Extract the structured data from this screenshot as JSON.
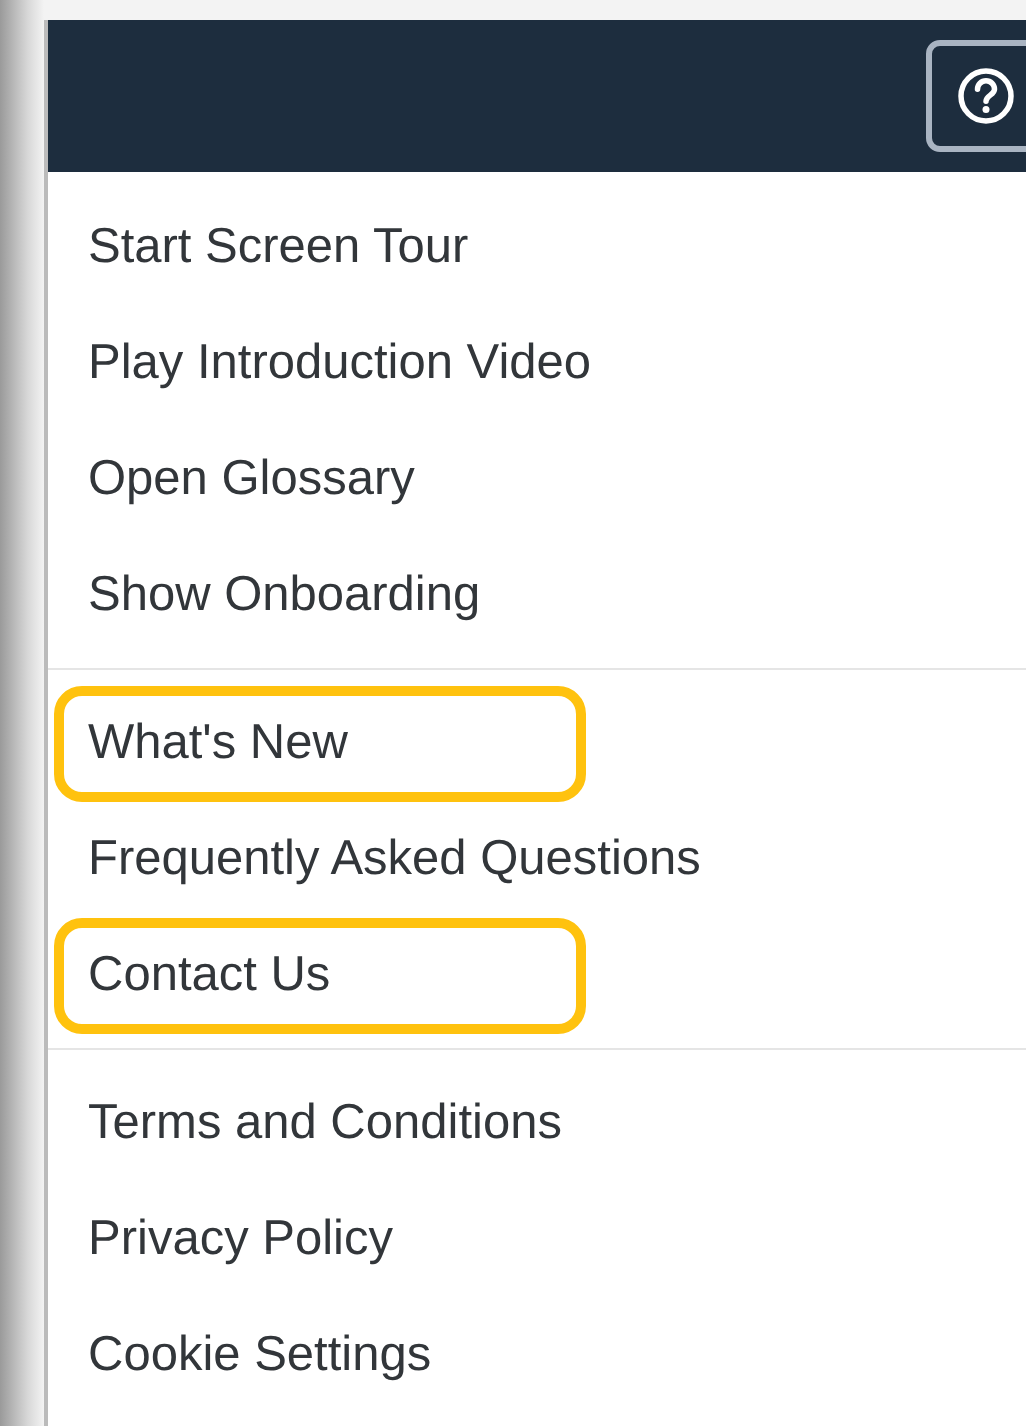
{
  "header": {
    "help_button": {
      "selected": true
    }
  },
  "menu": {
    "sections": [
      {
        "items": [
          {
            "label": "Start Screen Tour",
            "highlighted": false
          },
          {
            "label": "Play Introduction Video",
            "highlighted": false
          },
          {
            "label": "Open Glossary",
            "highlighted": false
          },
          {
            "label": "Show Onboarding",
            "highlighted": false
          }
        ]
      },
      {
        "items": [
          {
            "label": "What's New",
            "highlighted": true
          },
          {
            "label": "Frequently Asked Questions",
            "highlighted": false
          },
          {
            "label": "Contact Us",
            "highlighted": true
          }
        ]
      },
      {
        "items": [
          {
            "label": "Terms and Conditions",
            "highlighted": false
          },
          {
            "label": "Privacy Policy",
            "highlighted": false
          },
          {
            "label": "Cookie Settings",
            "highlighted": false
          }
        ]
      }
    ]
  }
}
